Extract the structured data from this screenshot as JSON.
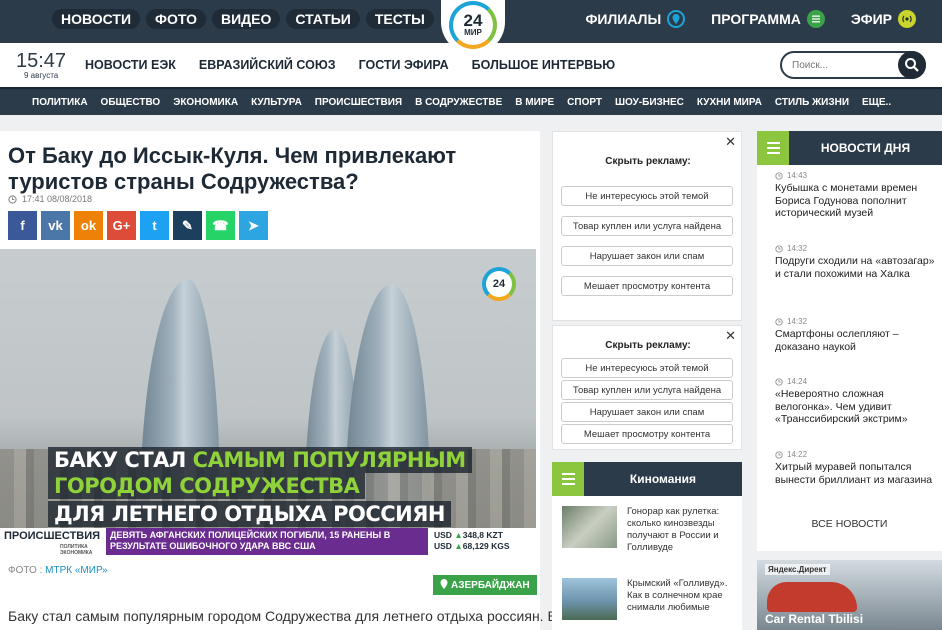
{
  "topnav": {
    "items": [
      "НОВОСТИ",
      "ФОТО",
      "ВИДЕО",
      "СТАТЬИ",
      "ТЕСТЫ"
    ],
    "logo_number": "24",
    "logo_text": "МИР",
    "right": [
      {
        "label": "ФИЛИАЛЫ",
        "icon": "location-pin-icon",
        "color": "#1ca3d8"
      },
      {
        "label": "ПРОГРАММА",
        "icon": "list-icon",
        "color": "#3aa34a"
      },
      {
        "label": "ЭФИР",
        "icon": "broadcast-icon",
        "color": "#c9d52a"
      }
    ]
  },
  "secbar": {
    "time": "15:47",
    "date": "9 августа",
    "items": [
      "НОВОСТИ ЕЭК",
      "ЕВРАЗИЙСКИЙ СОЮЗ",
      "ГОСТИ ЭФИРА",
      "БОЛЬШОЕ ИНТЕРВЬЮ"
    ],
    "search_placeholder": "Поиск..."
  },
  "categories": [
    "ПОЛИТИКА",
    "ОБЩЕСТВО",
    "ЭКОНОМИКА",
    "КУЛЬТУРА",
    "ПРОИСШЕСТВИЯ",
    "В СОДРУЖЕСТВЕ",
    "В МИРЕ",
    "СПОРТ",
    "ШОУ-БИЗНЕС",
    "КУХНИ МИРА",
    "СТИЛЬ ЖИЗНИ",
    "ЕЩЕ.."
  ],
  "article": {
    "title": "От Баку до Иссык-Куля. Чем привлекают туристов страны Содружества?",
    "datetime": "17:41 08/08/2018",
    "share": [
      {
        "name": "facebook",
        "glyph": "f",
        "color": "#3b5998"
      },
      {
        "name": "vk",
        "glyph": "vk",
        "color": "#4a76a8"
      },
      {
        "name": "odnoklassniki",
        "glyph": "ok",
        "color": "#ee8208"
      },
      {
        "name": "google-plus",
        "glyph": "G+",
        "color": "#dd4b39"
      },
      {
        "name": "twitter",
        "glyph": "t",
        "color": "#1da1f2"
      },
      {
        "name": "livejournal",
        "glyph": "✎",
        "color": "#1d3f5e"
      },
      {
        "name": "whatsapp",
        "glyph": "☎",
        "color": "#25d366"
      },
      {
        "name": "telegram",
        "glyph": "➤",
        "color": "#2ca5e0"
      }
    ],
    "photo_logo": "24",
    "caption": {
      "line1_a": "БАКУ СТАЛ ",
      "line1_b": "САМЫМ ПОПУЛЯРНЫМ",
      "line2": "ГОРОДОМ СОДРУЖЕСТВА",
      "line3": "ДЛЯ ЛЕТНЕГО ОТДЫХА РОССИЯН"
    },
    "ticker": {
      "label": "ПРОИСШЕСТВИЯ",
      "sublabel": "ПОЛИТИКА ЭКОНОМИКА",
      "text": "ДЕВЯТЬ АФГАНСКИХ ПОЛИЦЕЙСКИХ ПОГИБЛИ, 15 РАНЕНЫ В РЕЗУЛЬТАТЕ ОШИБОЧНОГО УДАРА ВВС США",
      "rate1_label": "USD",
      "rate1_value": "348,8 KZT",
      "rate2_label": "USD",
      "rate2_value": "68,129 KGS"
    },
    "credit_prefix": "ФОТО : ",
    "credit_link": "МТРК «МИР»",
    "tag": "АЗЕРБАЙДЖАН",
    "body": "Баку стал самым популярным городом Содружества для летнего отдыха россиян. В"
  },
  "ads": {
    "title": "Скрыть рекламу:",
    "options": [
      "Не интересуюсь этой темой",
      "Товар куплен или услуга найдена",
      "Нарушает закон или спам",
      "Мешает просмотру контента"
    ]
  },
  "kino": {
    "title": "Киномания",
    "items": [
      "Гонорар как рулетка: сколько кинозвезды получают в России и Голливуде",
      "Крымский «Голливуд». Как в солнечном крае снимали любимые"
    ]
  },
  "news": {
    "title": "НОВОСТИ ДНЯ",
    "items": [
      {
        "time": "14:43",
        "text": "Кубышка с монетами времен Бориса Годунова пополнит исторический музей"
      },
      {
        "time": "14:32",
        "text": "Подруги сходили на «автозагар» и стали похожими на Халка"
      },
      {
        "time": "14:32",
        "text": "Смартфоны ослепляют – доказано наукой"
      },
      {
        "time": "14:24",
        "text": "«Невероятно сложная велогонка». Чем удивит «Транссибирский экстрим»"
      },
      {
        "time": "14:22",
        "text": "Хитрый муравей попытался вынести бриллиант из магазина"
      }
    ],
    "all_label": "ВСЕ НОВОСТИ"
  },
  "promo": {
    "tag": "Яндекс.Директ",
    "title": "Car Rental Tbilisi"
  },
  "colors": {
    "navy": "#2c3b49",
    "accent_green": "#8cc63f",
    "link_blue": "#1a8fc2"
  }
}
